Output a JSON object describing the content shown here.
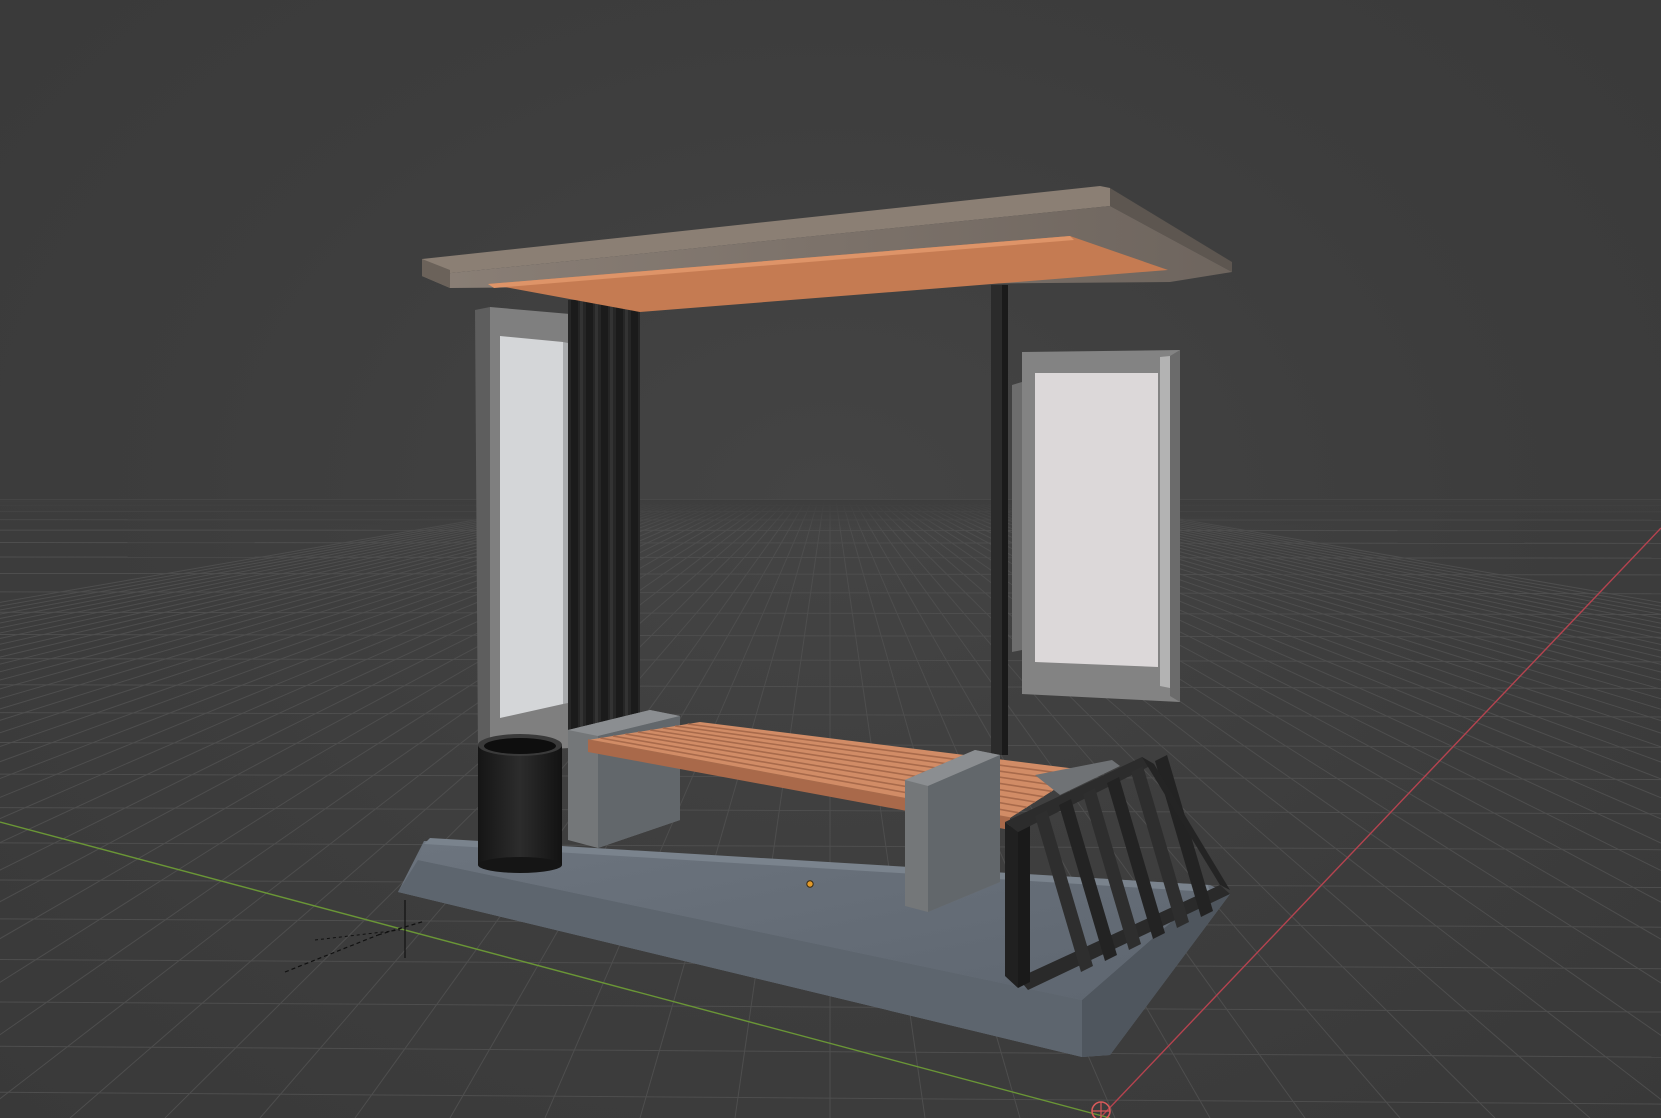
{
  "viewport": {
    "background": "#3d3d3d",
    "grid_color": "#4e4e4e",
    "x_axis_color": "#b5434f",
    "y_axis_color": "#6a9636",
    "origin_color": "#d85a5a"
  },
  "object": {
    "roof_color": "#7a6f66",
    "roof_underside_color": "#c57b52",
    "frame_color": "#262626",
    "panel_frame_color": "#808080",
    "panel_glass_color": "#d6d6d8",
    "bench_wood_color": "#d18c66",
    "bench_support_color": "#747779",
    "base_color": "#6a727c",
    "bin_color": "#1e1e1e",
    "rack_color": "#2a2a2a",
    "origin_dot_color": "#e39a2a"
  },
  "gizmos": [
    "3d-cursor",
    "world-origin",
    "object-origin"
  ]
}
